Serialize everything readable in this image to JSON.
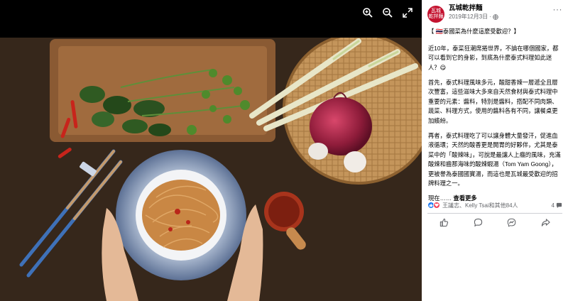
{
  "viewer": {
    "toolbar": [
      "zoom-in-icon",
      "zoom-out-icon",
      "fullscreen-icon"
    ]
  },
  "post": {
    "avatar_text_1": "瓦城",
    "avatar_text_2": "乾拌麵",
    "page_name": "瓦城乾拌麵",
    "date": "2019年12月3日",
    "more": "···",
    "title": "【 🇹🇭泰國菜為什麼這麼受歡迎？】",
    "paragraph_1": "近10年，泰菜狂潮席捲世界，不論在哪個國家，都可以看到它的身影，到底為什麼泰式料理如此迷人？😋",
    "paragraph_2": "首先，泰式料理風味多元，酸甜香辣一層遞全且層次豐富，這些滋味大多來自天然食材與泰式料理中重要的元素：醬料，特別是醬料，搭配不同肉類、蔬菜、料理方式，使用的醬料各有不同，讓餐桌更加繽紛。",
    "paragraph_3": "再者，泰式料理吃了可以讓身體大量發汗，促進血液循環；天然的酸香更是開胃的好夥伴，尤其是泰菜中的「酸辣味」，可說是最讓人上癮的風味，充滿酸辣和齒那海味的酸辣蝦湯（Tom Yam Goong），更被譽為泰國國寶湯，而這也是瓦城最受歡迎的招牌料理之一。",
    "paragraph_4_prefix": "現在……",
    "see_more": "查看更多",
    "reactors": "王議志、Kelly Tsai和其他84人",
    "comment_count": "4"
  },
  "actions": [
    "like-icon",
    "comment-icon",
    "share-icon",
    "send-icon",
    "messenger-icon"
  ],
  "colors": {
    "brand": "#c4122f",
    "like": "#1877f2",
    "love": "#f33e58",
    "text_secondary": "#65676b"
  }
}
